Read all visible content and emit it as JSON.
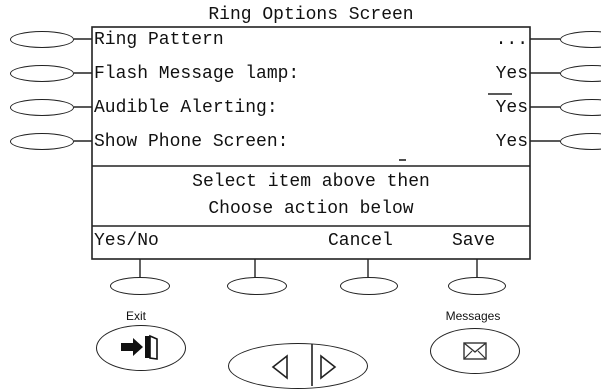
{
  "screen": {
    "title": "Ring Options Screen",
    "rows": [
      {
        "label": "Ring Pattern",
        "value": "..."
      },
      {
        "label": "Flash Message lamp:",
        "value": "Yes"
      },
      {
        "label": "Audible Alerting:",
        "value": "Yes"
      },
      {
        "label": "Show Phone Screen:",
        "value": "Yes"
      }
    ],
    "prompt_line1": "Select item above then",
    "prompt_line2": "Choose action below",
    "softkeys": [
      "Yes/No",
      "Cancel",
      "Save"
    ]
  },
  "buttons": {
    "exit_label": "Exit",
    "messages_label": "Messages"
  }
}
